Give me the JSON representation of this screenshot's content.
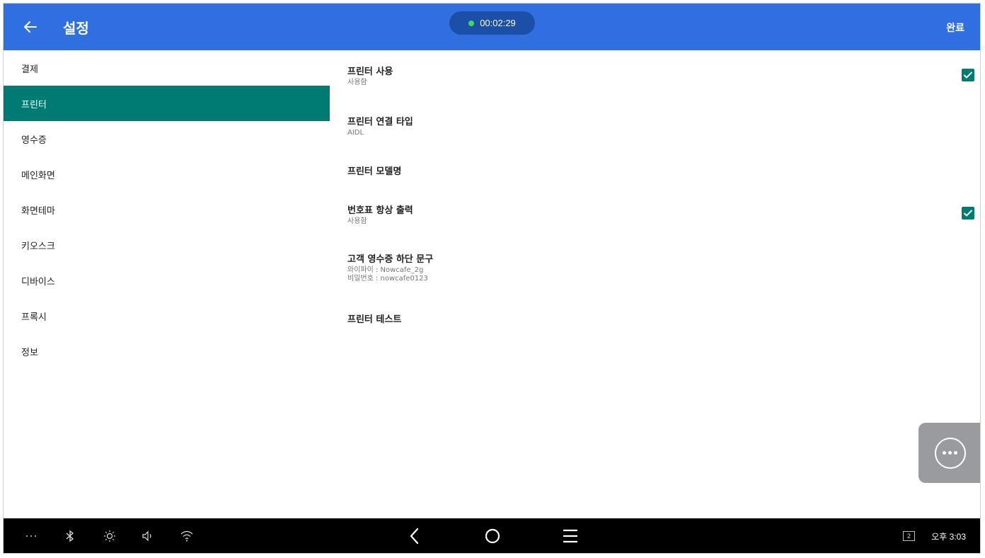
{
  "appbar": {
    "title": "설정",
    "timer": "00:02:29",
    "done_label": "완료"
  },
  "sidebar": {
    "items": [
      {
        "label": "결제",
        "active": false
      },
      {
        "label": "프린터",
        "active": true
      },
      {
        "label": "영수증",
        "active": false
      },
      {
        "label": "메인화면",
        "active": false
      },
      {
        "label": "화면테마",
        "active": false
      },
      {
        "label": "키오스크",
        "active": false
      },
      {
        "label": "디바이스",
        "active": false
      },
      {
        "label": "프록시",
        "active": false
      },
      {
        "label": "정보",
        "active": false
      }
    ]
  },
  "prefs": {
    "use_printer": {
      "title": "프린터 사용",
      "summary": "사용함",
      "checked": true
    },
    "connection_type": {
      "title": "프린터 연결 타입",
      "summary": "AIDL"
    },
    "model_name": {
      "title": "프린터 모델명"
    },
    "always_print_number": {
      "title": "번호표 항상 출력",
      "summary": "사용함",
      "checked": true
    },
    "receipt_footer": {
      "title": "고객 영수증 하단 문구",
      "summary_line1": "와이파이 : Nowcafe_2g",
      "summary_line2": "비밀번호 : nowcafe0123"
    },
    "printer_test": {
      "title": "프린터 테스트"
    }
  },
  "statusbar": {
    "screen_badge": "2",
    "time": "오후 3:03"
  },
  "colors": {
    "appbar": "#2f6fe0",
    "accent": "#007b73",
    "timer_dot": "#3ddc56"
  }
}
